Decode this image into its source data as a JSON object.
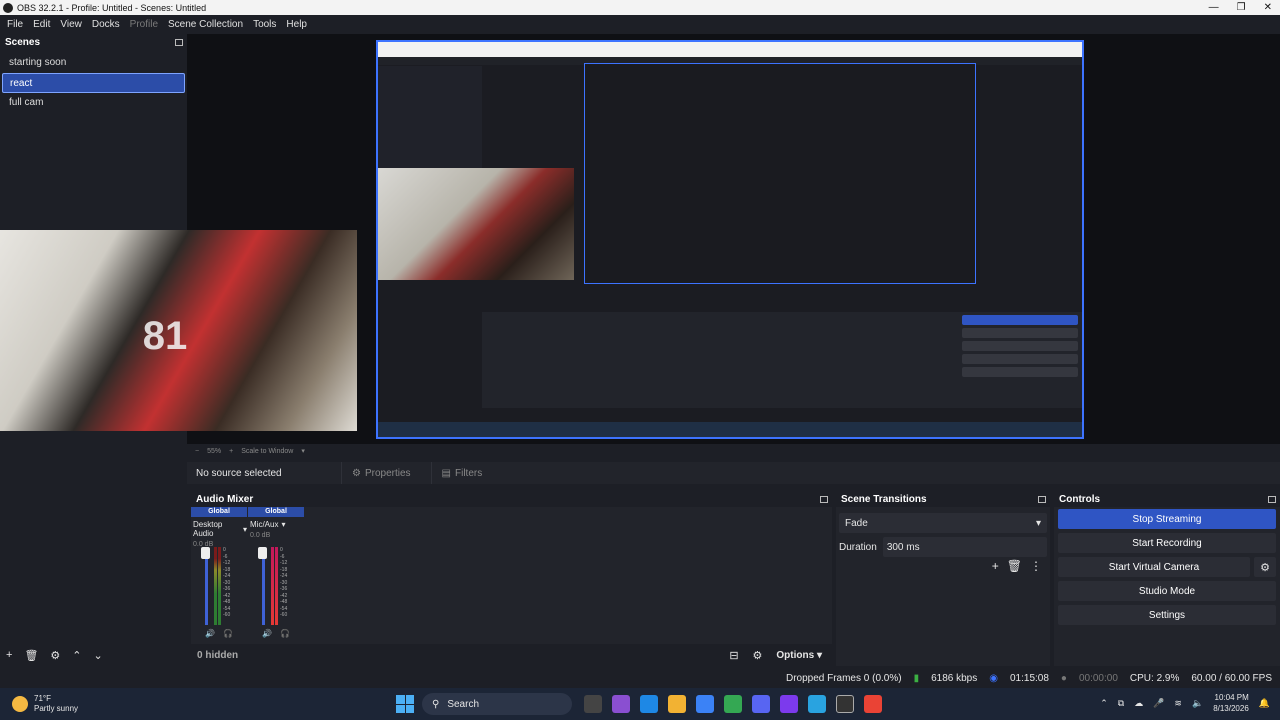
{
  "window": {
    "title": "OBS 32.2.1 - Profile: Untitled - Scenes: Untitled"
  },
  "menu": [
    {
      "label": "File",
      "disabled": false
    },
    {
      "label": "Edit",
      "disabled": false
    },
    {
      "label": "View",
      "disabled": false
    },
    {
      "label": "Docks",
      "disabled": false
    },
    {
      "label": "Profile",
      "disabled": true
    },
    {
      "label": "Scene Collection",
      "disabled": false
    },
    {
      "label": "Tools",
      "disabled": false
    },
    {
      "label": "Help",
      "disabled": false
    }
  ],
  "scenes": {
    "title": "Scenes",
    "items": [
      "starting soon",
      "react",
      "full cam"
    ],
    "active_index": 1
  },
  "camera_overlay_text": "81",
  "zoom": {
    "percent": "55%",
    "mode": "Scale to Window"
  },
  "source_bar": {
    "no_source": "No source selected",
    "properties": "Properties",
    "filters": "Filters"
  },
  "audio_mixer": {
    "title": "Audio Mixer",
    "channels": [
      {
        "global": "Global",
        "name": "Desktop Audio",
        "db": "0.0 dB"
      },
      {
        "global": "Global",
        "name": "Mic/Aux",
        "db": "0.0 dB"
      }
    ],
    "ticks": [
      "0",
      "-6",
      "-12",
      "-18",
      "-24",
      "-30",
      "-36",
      "-42",
      "-48",
      "-54",
      "-60"
    ],
    "hidden": "0 hidden",
    "options": "Options"
  },
  "transitions": {
    "title": "Scene Transitions",
    "selected": "Fade",
    "duration_label": "Duration",
    "duration_value": "300 ms"
  },
  "controls": {
    "title": "Controls",
    "stop_streaming": "Stop Streaming",
    "start_recording": "Start Recording",
    "start_virtual_camera": "Start Virtual Camera",
    "studio_mode": "Studio Mode",
    "settings": "Settings"
  },
  "status": {
    "dropped_frames": "Dropped Frames 0 (0.0%)",
    "bitrate": "6186 kbps",
    "stream_time": "01:15:08",
    "record_time": "00:00:00",
    "cpu": "CPU: 2.9%",
    "fps": "60.00 / 60.00 FPS"
  },
  "taskbar": {
    "temperature": "71°F",
    "weather": "Partly sunny",
    "search": "Search",
    "time": "10:04 PM",
    "date": "8/13/2026"
  },
  "colors": {
    "accent": "#2f55c4",
    "highlight_border": "#3d73ff"
  }
}
